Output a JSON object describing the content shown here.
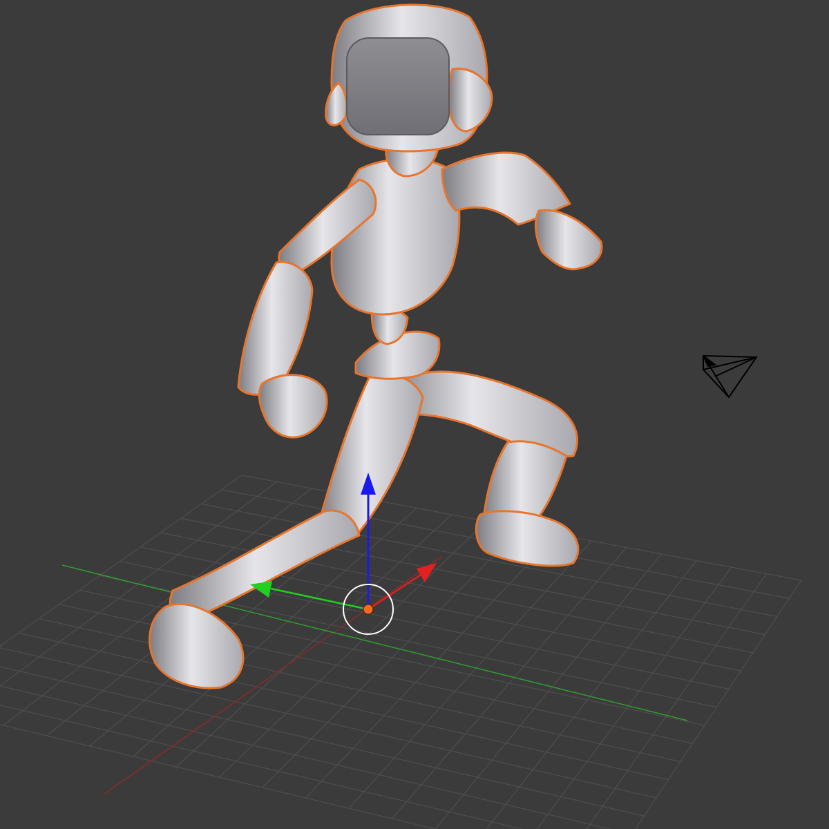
{
  "viewport": {
    "background_color": "#3b3b3b",
    "grid_color": "#4e4e4e",
    "axis_x_color": "#8a2b2b",
    "axis_y_color": "#2f9e2f"
  },
  "selected_object": {
    "kind": "character-mesh",
    "shading": "solid",
    "base_color": "#b9b9bd",
    "highlight_color": "#e6e6ea",
    "shadow_color": "#7c7c82",
    "outline_color": "#e8752c",
    "selected": true
  },
  "manipulator": {
    "type": "translate",
    "x_color": "#e22020",
    "y_color": "#22d022",
    "z_color": "#1a1aee"
  },
  "origin_pivot": {
    "color": "#ff6a1a",
    "ring_color": "#ffffff"
  },
  "camera": {
    "icon": "camera-icon",
    "color": "#000000"
  }
}
